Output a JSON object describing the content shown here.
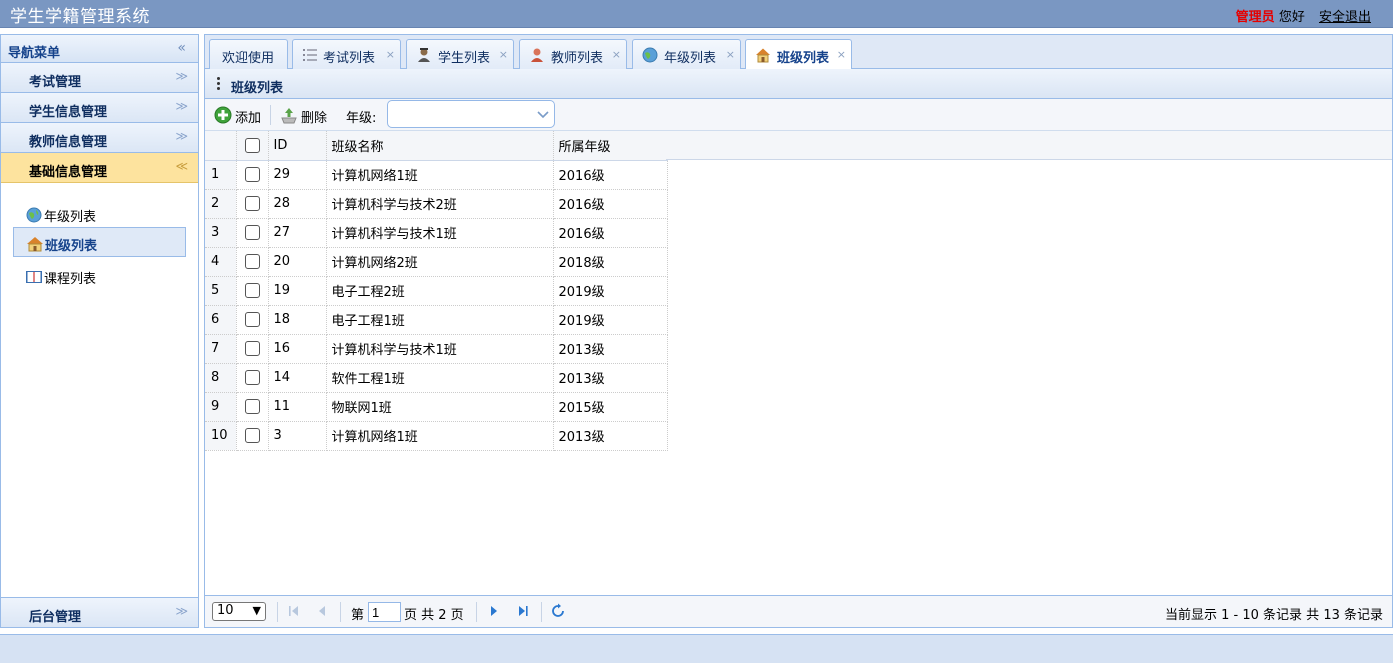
{
  "header": {
    "app_title": "学生学籍管理系统",
    "role": "管理员",
    "greeting": "您好",
    "logout": "安全退出"
  },
  "sidebar": {
    "title": "导航菜单",
    "collapse_glyph": "«",
    "sections": [
      {
        "label": "考试管理",
        "expanded": false
      },
      {
        "label": "学生信息管理",
        "expanded": false
      },
      {
        "label": "教师信息管理",
        "expanded": false
      },
      {
        "label": "基础信息管理",
        "expanded": true
      }
    ],
    "sub_items": [
      {
        "label": "年级列表",
        "icon": "globe-icon",
        "selected": false
      },
      {
        "label": "班级列表",
        "icon": "home-icon",
        "selected": true
      },
      {
        "label": "课程列表",
        "icon": "book-icon",
        "selected": false
      }
    ],
    "bottom_section": "后台管理",
    "expand_glyph": "≫",
    "collapse_section_glyph": "≪"
  },
  "tabs": [
    {
      "label": "欢迎使用",
      "icon": "",
      "closable": false,
      "active": false
    },
    {
      "label": "考试列表",
      "icon": "list-icon",
      "closable": true,
      "active": false
    },
    {
      "label": "学生列表",
      "icon": "student-icon",
      "closable": true,
      "active": false
    },
    {
      "label": "教师列表",
      "icon": "teacher-icon",
      "closable": true,
      "active": false
    },
    {
      "label": "年级列表",
      "icon": "globe-icon",
      "closable": true,
      "active": false
    },
    {
      "label": "班级列表",
      "icon": "home-icon",
      "closable": true,
      "active": true
    }
  ],
  "tab_close_glyph": "×",
  "panel": {
    "title": "班级列表"
  },
  "toolbar": {
    "add_label": "添加",
    "delete_label": "删除",
    "grade_label": "年级:",
    "grade_value": ""
  },
  "grid": {
    "columns": [
      "ID",
      "班级名称",
      "所属年级"
    ],
    "rows": [
      {
        "n": "1",
        "id": "29",
        "name": "计算机网络1班",
        "grade": "2016级"
      },
      {
        "n": "2",
        "id": "28",
        "name": "计算机科学与技术2班",
        "grade": "2016级"
      },
      {
        "n": "3",
        "id": "27",
        "name": "计算机科学与技术1班",
        "grade": "2016级"
      },
      {
        "n": "4",
        "id": "20",
        "name": "计算机网络2班",
        "grade": "2018级"
      },
      {
        "n": "5",
        "id": "19",
        "name": "电子工程2班",
        "grade": "2019级"
      },
      {
        "n": "6",
        "id": "18",
        "name": "电子工程1班",
        "grade": "2019级"
      },
      {
        "n": "7",
        "id": "16",
        "name": "计算机科学与技术1班",
        "grade": "2013级"
      },
      {
        "n": "8",
        "id": "14",
        "name": "软件工程1班",
        "grade": "2013级"
      },
      {
        "n": "9",
        "id": "11",
        "name": "物联网1班",
        "grade": "2015级"
      },
      {
        "n": "10",
        "id": "3",
        "name": "计算机网络1班",
        "grade": "2013级"
      }
    ]
  },
  "pager": {
    "page_size": "10",
    "page_prefix": "第",
    "page_value": "1",
    "page_suffix": "页 共 2 页",
    "info": "当前显示 1 - 10 条记录 共 13 条记录"
  },
  "colors": {
    "header_bg": "#7a97c2",
    "accent_border": "#99bbe8",
    "active_section": "#fde39e",
    "role_red": "#e60000"
  }
}
